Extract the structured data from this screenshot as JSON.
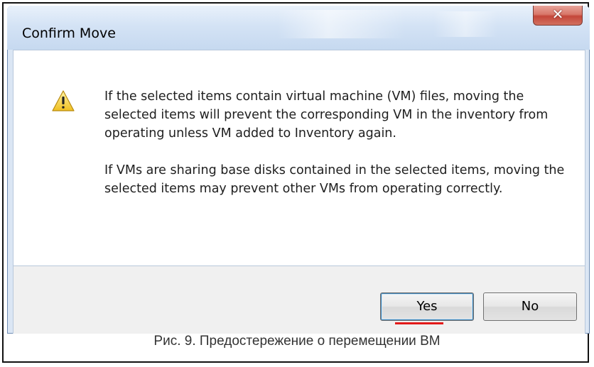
{
  "dialog": {
    "title": "Confirm Move",
    "close_icon": "close-icon",
    "warning_icon": "warning-triangle-icon",
    "message_paragraphs": [
      "If the selected items contain virtual machine (VM) files, moving the selected items will prevent the corresponding VM in the inventory from operating unless VM added to Inventory again.",
      "If VMs are sharing base disks contained in the selected items, moving the selected items may prevent other VMs from operating correctly."
    ],
    "buttons": {
      "yes_label": "Yes",
      "no_label": "No"
    }
  },
  "caption": "Рис. 9. Предостережение о перемещении ВМ",
  "colors": {
    "titlebar": "#c6d9f0",
    "close_button": "#c4473a",
    "annotation_underline": "#e21a1a",
    "button_area": "#f0f0f0"
  }
}
